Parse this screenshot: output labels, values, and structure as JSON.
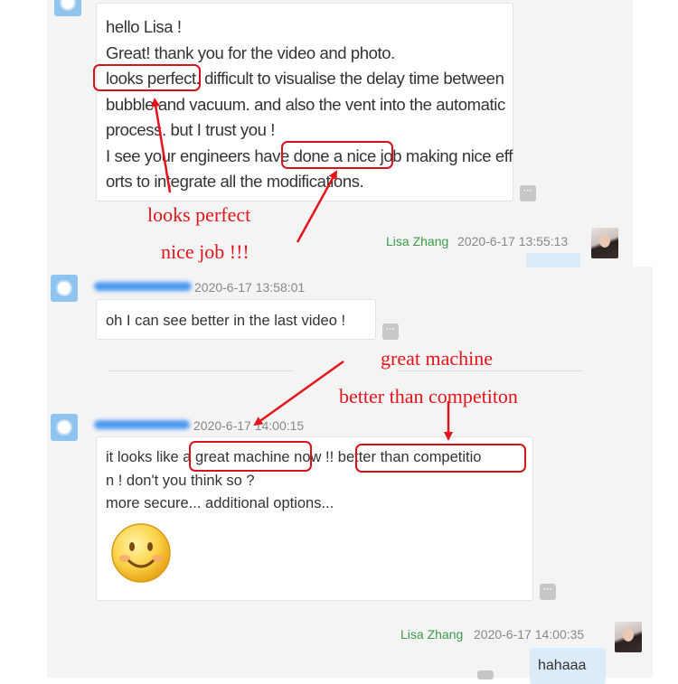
{
  "messages": [
    {
      "lines": [
        "hello Lisa !",
        "Great! thank you for the video and photo.",
        "looks perfect. difficult to visualise the delay time between",
        "bubble and vacuum. and also the vent into the automatic",
        "process. but I trust you !",
        "I see your engineers have done a nice job making nice eff",
        "orts to integrate all the modifications."
      ]
    },
    {
      "sender": "Lisa Zhang",
      "timestamp": "2020-6-17 13:55:13"
    },
    {
      "timestamp": "2020-6-17 13:58:01",
      "text": "oh I can see better in the last video !"
    },
    {
      "timestamp": "2020-6-17 14:00:15",
      "lines": [
        "it looks like a great machine now !! better than competitio",
        "n ! don't you think so ?",
        "more secure... additional options..."
      ],
      "emoji": "slightly-smiling-face"
    },
    {
      "sender": "Lisa Zhang",
      "timestamp": "2020-6-17 14:00:35",
      "text": "hahaaa"
    }
  ],
  "more_button_label": "···",
  "annotations": {
    "looks_perfect": "looks perfect",
    "nice_job": "nice job !!!",
    "great_machine": "great machine",
    "better_than_competition": "better than competiton"
  },
  "colors": {
    "annotation_red": "#e3141b",
    "sender_green": "#3d9a48",
    "chat_background": "#f4f4f4",
    "outgoing_bubble": "#dcebfa"
  }
}
